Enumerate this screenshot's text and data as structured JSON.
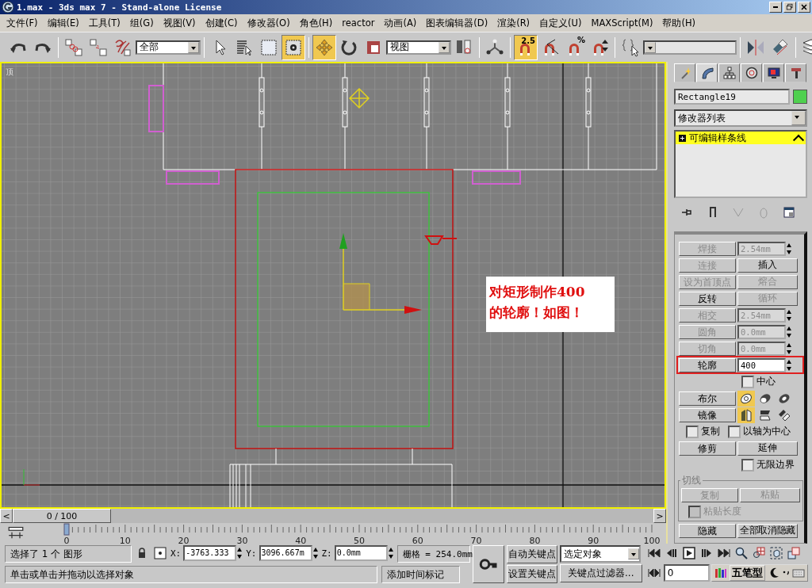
{
  "window": {
    "title": "1.max - 3ds max 7  - Stand-alone License"
  },
  "menu": [
    "文件(F)",
    "编辑(E)",
    "工具(T)",
    "组(G)",
    "视图(V)",
    "创建(C)",
    "修改器(O)",
    "角色(H)",
    "reactor",
    "动画(A)",
    "图表编辑器(D)",
    "渲染(R)",
    "自定义(U)",
    "MAXScript(M)",
    "帮助(H)"
  ],
  "toolbar": [
    [
      {
        "kind": "undo",
        "selected": false
      },
      {
        "kind": "redo",
        "selected": false
      }
    ],
    [
      {
        "kind": "link",
        "selected": false
      },
      {
        "kind": "unlink",
        "selected": false
      },
      {
        "kind": "bind",
        "selected": false
      },
      {
        "kind": "dropdown",
        "value": "全部"
      }
    ],
    [
      {
        "kind": "select",
        "selected": false
      },
      {
        "kind": "select-name",
        "selected": false
      },
      {
        "kind": "region",
        "selected": false
      },
      {
        "kind": "crossing",
        "selected": true
      }
    ],
    [
      {
        "kind": "move",
        "selected": true
      },
      {
        "kind": "rotate",
        "selected": false
      },
      {
        "kind": "scale",
        "selected": false
      },
      {
        "kind": "dropdown",
        "value": "视图"
      },
      {
        "kind": "pivot",
        "selected": false
      }
    ],
    [
      {
        "kind": "manipulate",
        "selected": false
      }
    ],
    [
      {
        "kind": "snap",
        "label": "2.5",
        "selected": true
      },
      {
        "kind": "angle-snap",
        "selected": false
      },
      {
        "kind": "percent-snap",
        "label": "%",
        "selected": false
      },
      {
        "kind": "spinner-snap",
        "selected": false
      }
    ],
    [
      {
        "kind": "named-sel",
        "selected": false
      },
      {
        "kind": "dropdown"
      }
    ],
    [
      {
        "kind": "mirror",
        "selected": false
      },
      {
        "kind": "align",
        "selected": false
      }
    ],
    [
      {
        "kind": "layers",
        "selected": false
      }
    ]
  ],
  "viewport": {
    "label": "顶",
    "active": true,
    "annotation": "对矩形制作400\n的轮廓！如图！"
  },
  "time_slider": {
    "label": "0 / 100",
    "level": 0,
    "prev": "<",
    "next": ">"
  },
  "ruler": {
    "ticks": [
      "0",
      "10",
      "20",
      "30",
      "40",
      "50",
      "60",
      "70",
      "80",
      "90",
      "100"
    ]
  },
  "command_panel": {
    "tabs": [
      {
        "kind": "create",
        "selected": false
      },
      {
        "kind": "modify",
        "selected": true
      },
      {
        "kind": "hierarchy",
        "selected": false
      },
      {
        "kind": "motion",
        "selected": false
      },
      {
        "kind": "display",
        "selected": false
      },
      {
        "kind": "utilities",
        "selected": false
      }
    ],
    "object": {
      "name": "Rectangle19",
      "color": "#4fd04f"
    },
    "modifier_list": "修改器列表",
    "stack": [
      {
        "label": "可编辑样条线",
        "selected": true
      }
    ],
    "rollout": [
      {
        "kind": "button-field",
        "highlighted": false,
        "button": {
          "label": "焊接",
          "disabled": true
        },
        "field": {
          "value": "2.54mm",
          "disabled": true
        }
      },
      {
        "kind": "button-pair",
        "buttons": [
          {
            "label": "连接",
            "disabled": true
          },
          {
            "label": "插入",
            "disabled": false
          }
        ]
      },
      {
        "kind": "button-pair",
        "buttons": [
          {
            "label": "设为首顶点",
            "disabled": true
          },
          {
            "label": "熔合",
            "disabled": true
          }
        ]
      },
      {
        "kind": "button-pair",
        "buttons": [
          {
            "label": "反转",
            "disabled": false
          },
          {
            "label": "循环",
            "disabled": true
          }
        ]
      },
      {
        "kind": "button-field",
        "highlighted": false,
        "button": {
          "label": "相交",
          "disabled": true
        },
        "field": {
          "value": "2.54mm",
          "disabled": true
        }
      },
      {
        "kind": "button-field",
        "highlighted": false,
        "button": {
          "label": "圆角",
          "disabled": true
        },
        "field": {
          "value": "0.0mm",
          "disabled": true
        }
      },
      {
        "kind": "button-field",
        "highlighted": false,
        "button": {
          "label": "切角",
          "disabled": true
        },
        "field": {
          "value": "0.0mm",
          "disabled": true
        }
      },
      {
        "kind": "button-field",
        "highlighted": true,
        "button": {
          "label": "轮廓",
          "disabled": false
        },
        "field": {
          "value": "400",
          "disabled": false
        }
      },
      {
        "kind": "checkbox",
        "label": "中心",
        "checked": false,
        "disabled": false
      },
      {
        "kind": "button-icons",
        "button": {
          "label": "布尔",
          "disabled": false
        },
        "options": [
          {
            "kind": "union",
            "selected": true
          },
          {
            "kind": "subtract",
            "selected": false
          },
          {
            "kind": "intersect",
            "selected": false
          }
        ]
      },
      {
        "kind": "button-icons",
        "button": {
          "label": "镜像",
          "disabled": false
        },
        "options": [
          {
            "kind": "mirror-h",
            "selected": true
          },
          {
            "kind": "mirror-v",
            "selected": false
          },
          {
            "kind": "mirror-both",
            "selected": false
          }
        ]
      },
      {
        "kind": "checkbox-pair",
        "items": [
          {
            "label": "复制",
            "checked": false,
            "disabled": false
          },
          {
            "label": "以轴为中心",
            "checked": false,
            "disabled": false
          }
        ]
      },
      {
        "kind": "button-pair",
        "buttons": [
          {
            "label": "修剪",
            "disabled": false
          },
          {
            "label": "延伸",
            "disabled": false
          }
        ]
      },
      {
        "kind": "checkbox",
        "label": "无限边界",
        "checked": false,
        "disabled": false
      },
      {
        "kind": "group",
        "title": "切线",
        "rows": [
          {
            "kind": "button-pair",
            "buttons": [
              {
                "label": "复制",
                "disabled": true
              },
              {
                "label": "粘贴",
                "disabled": true
              }
            ]
          },
          {
            "kind": "checkbox",
            "label": "粘贴长度",
            "checked": false,
            "disabled": true
          }
        ]
      },
      {
        "kind": "button-pair",
        "buttons": [
          {
            "label": "隐藏",
            "disabled": false
          },
          {
            "label": "全部取消隐藏",
            "disabled": false
          }
        ]
      }
    ]
  },
  "status": {
    "selection": "选择了 1 个 图形",
    "coords": [
      {
        "label": "X:",
        "value": "-3763.333"
      },
      {
        "label": "Y:",
        "value": "3096.667m"
      },
      {
        "label": "Z:",
        "value": "0.0mm"
      }
    ],
    "grid": "栅格 = 254.0mm",
    "prompt": "单击或单击并拖动以选择对象",
    "time_tag": "添加时间标记",
    "auto_key": {
      "label": "自动关键点",
      "selected": false
    },
    "set_key": "设置关键点",
    "key_mode": "选定对象",
    "key_filters": "关键点过滤器...",
    "frame": "0",
    "ime": "五笔型"
  }
}
